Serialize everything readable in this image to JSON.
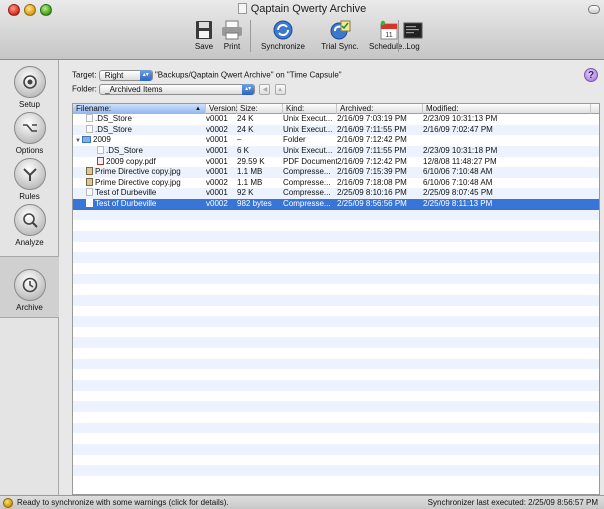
{
  "window": {
    "title": "Qaptain Qwerty Archive"
  },
  "toolbar": {
    "save": "Save",
    "print": "Print",
    "synchronize": "Synchronize",
    "trial_sync": "Trial Sync.",
    "schedule": "Schedule...",
    "log": "Log"
  },
  "sidebar": {
    "setup": "Setup",
    "options": "Options",
    "rules": "Rules",
    "analyze": "Analyze",
    "archive": "Archive"
  },
  "target": {
    "label": "Target:",
    "value": "Right",
    "description": "\"Backups/Qaptain Qwert Archive\" on \"Time Capsule\""
  },
  "folder": {
    "label": "Folder:",
    "value": "_Archived Items"
  },
  "help": {
    "label": "?"
  },
  "table": {
    "columns": [
      "Filename:",
      "Version:",
      "Size:",
      "Kind:",
      "Archived:",
      "Modified:"
    ],
    "rows": [
      {
        "indent": 1,
        "icon": "unix",
        "name": ".DS_Store",
        "version": "v0001",
        "size": "24 K",
        "kind": "Unix Execut...",
        "archived": "2/16/09 7:03:19 PM",
        "modified": "2/23/09 10:31:13 PM"
      },
      {
        "indent": 1,
        "icon": "unix",
        "name": ".DS_Store",
        "version": "v0002",
        "size": "24 K",
        "kind": "Unix Execut...",
        "archived": "2/16/09 7:11:55 PM",
        "modified": "2/16/09 7:02:47 PM"
      },
      {
        "indent": 0,
        "icon": "folder",
        "name": "2009",
        "version": "v0001",
        "size": "–",
        "kind": "Folder",
        "archived": "2/16/09 7:12:42 PM",
        "modified": "",
        "expanded": true
      },
      {
        "indent": 2,
        "icon": "unix",
        "name": ".DS_Store",
        "version": "v0001",
        "size": "6 K",
        "kind": "Unix Execut...",
        "archived": "2/16/09 7:11:55 PM",
        "modified": "2/23/09 10:31:18 PM"
      },
      {
        "indent": 2,
        "icon": "pdf",
        "name": "2009 copy.pdf",
        "version": "v0001",
        "size": "29.59 K",
        "kind": "PDF Document",
        "archived": "2/16/09 7:12:42 PM",
        "modified": "12/8/08 11:48:27 PM"
      },
      {
        "indent": 1,
        "icon": "jpg",
        "name": "Prime Directive copy.jpg",
        "version": "v0001",
        "size": "1.1 MB",
        "kind": "Compresse...",
        "archived": "2/16/09 7:15:39 PM",
        "modified": "6/10/06 7:10:48 AM"
      },
      {
        "indent": 1,
        "icon": "jpg",
        "name": "Prime Directive copy.jpg",
        "version": "v0002",
        "size": "1.1 MB",
        "kind": "Compresse...",
        "archived": "2/16/09 7:18:08 PM",
        "modified": "6/10/06 7:10:48 AM"
      },
      {
        "indent": 1,
        "icon": "unix",
        "name": "Test of Durbeville",
        "version": "v0001",
        "size": "92 K",
        "kind": "Compresse...",
        "archived": "2/25/09 8:10:16 PM",
        "modified": "2/25/09 8:07:45 PM"
      },
      {
        "indent": 1,
        "icon": "unix",
        "name": "Test of Durbeville",
        "version": "v0002",
        "size": "982 bytes",
        "kind": "Compresse...",
        "archived": "2/25/09 8:56:56 PM",
        "modified": "2/25/09 8:11:13 PM",
        "selected": true
      }
    ],
    "empty_rows": 25
  },
  "status": {
    "left": "Ready to synchronize with some warnings (click for details).",
    "right": "Synchronizer last executed:  2/25/09 8:56:57 PM"
  }
}
